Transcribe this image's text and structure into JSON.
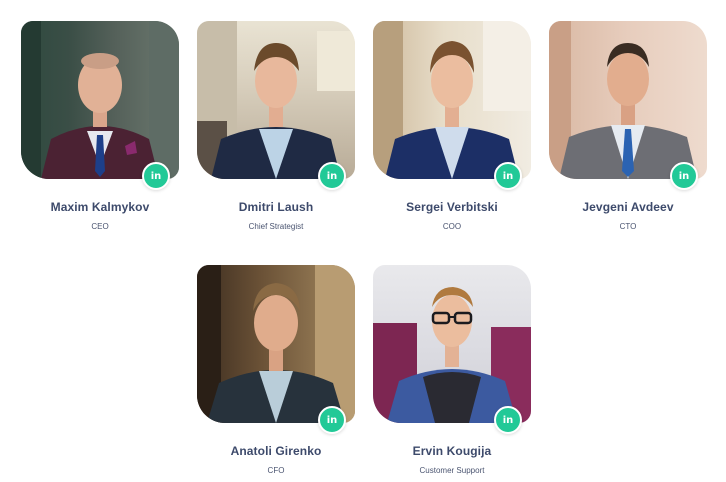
{
  "team": {
    "members": [
      {
        "name": "Maxim Kalmykov",
        "role": "CEO",
        "icon": "linkedin-icon",
        "icon_label": "in"
      },
      {
        "name": "Dmitri Laush",
        "role": "Chief Strategist",
        "icon": "linkedin-icon",
        "icon_label": "in"
      },
      {
        "name": "Sergei Verbitski",
        "role": "COO",
        "icon": "linkedin-icon",
        "icon_label": "in"
      },
      {
        "name": "Jevgeni Avdeev",
        "role": "CTO",
        "icon": "linkedin-icon",
        "icon_label": "in"
      },
      {
        "name": "Anatoli Girenko",
        "role": "CFO",
        "icon": "linkedin-icon",
        "icon_label": "in"
      },
      {
        "name": "Ervin Kougija",
        "role": "Customer Support",
        "icon": "linkedin-icon",
        "icon_label": "in"
      }
    ]
  },
  "colors": {
    "linkedin_badge": "#22c997",
    "name_text": "#3d4a6b",
    "role_text": "#4a5470"
  }
}
